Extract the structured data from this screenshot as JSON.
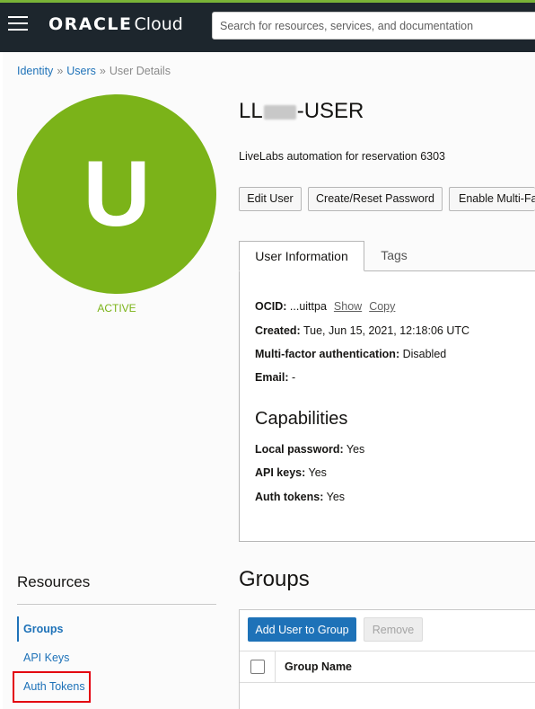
{
  "header": {
    "logo_oracle": "ORACLE",
    "logo_cloud": "Cloud",
    "search_placeholder": "Search for resources, services, and documentation"
  },
  "breadcrumb": {
    "items": [
      "Identity",
      "Users"
    ],
    "separator": "»",
    "current": "User Details"
  },
  "avatar": {
    "letter": "U",
    "status": "ACTIVE",
    "color": "#7bb319"
  },
  "user": {
    "name_prefix": "LL",
    "name_suffix": "-USER",
    "description": "LiveLabs automation for reservation 6303"
  },
  "actions": {
    "edit": "Edit User",
    "reset": "Create/Reset Password",
    "mfa": "Enable Multi-Fa"
  },
  "tabs": {
    "active": "User Information",
    "inactive": "Tags"
  },
  "info": {
    "ocid_label": "OCID:",
    "ocid_value": "...uittpa",
    "show": "Show",
    "copy": "Copy",
    "created_label": "Created:",
    "created_value": "Tue, Jun 15, 2021, 12:18:06 UTC",
    "mfa_label": "Multi-factor authentication:",
    "mfa_value": "Disabled",
    "email_label": "Email:",
    "email_value": "-"
  },
  "capabilities": {
    "title": "Capabilities",
    "local_label": "Local password:",
    "local_value": "Yes",
    "api_label": "API keys:",
    "api_value": "Yes",
    "auth_label": "Auth tokens:",
    "auth_value": "Yes"
  },
  "resources": {
    "title": "Resources",
    "items": [
      "Groups",
      "API Keys",
      "Auth Tokens"
    ]
  },
  "groups": {
    "title": "Groups",
    "add_button": "Add User to Group",
    "remove_button": "Remove",
    "column_group_name": "Group Name"
  },
  "colors": {
    "accent": "#1e72b8",
    "header_bg": "#1d262d",
    "highlight": "#e3000f"
  }
}
